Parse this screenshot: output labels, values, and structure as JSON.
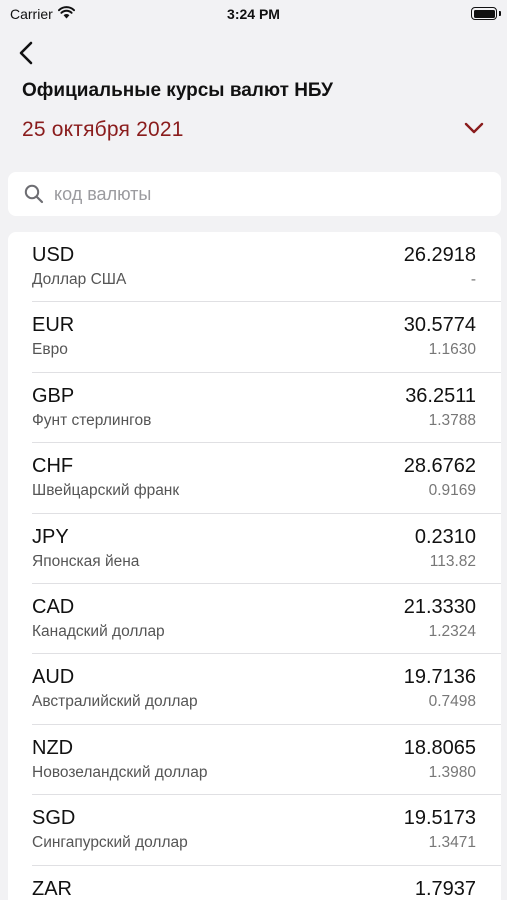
{
  "status_bar": {
    "carrier": "Carrier",
    "time": "3:24 PM"
  },
  "header": {
    "title": "Официальные курсы валют НБУ",
    "date": "25 октября 2021"
  },
  "search": {
    "placeholder": "код валюты",
    "value": ""
  },
  "colors": {
    "accent": "#8a1c1c",
    "background": "#f2f2f4"
  },
  "currencies": [
    {
      "code": "USD",
      "name": "Доллар США",
      "rate": "26.2918",
      "cross": "-"
    },
    {
      "code": "EUR",
      "name": "Евро",
      "rate": "30.5774",
      "cross": "1.1630"
    },
    {
      "code": "GBP",
      "name": "Фунт стерлингов",
      "rate": "36.2511",
      "cross": "1.3788"
    },
    {
      "code": "CHF",
      "name": "Швейцарский франк",
      "rate": "28.6762",
      "cross": "0.9169"
    },
    {
      "code": "JPY",
      "name": "Японская йена",
      "rate": "0.2310",
      "cross": "113.82"
    },
    {
      "code": "CAD",
      "name": "Канадский доллар",
      "rate": "21.3330",
      "cross": "1.2324"
    },
    {
      "code": "AUD",
      "name": "Австралийский доллар",
      "rate": "19.7136",
      "cross": "0.7498"
    },
    {
      "code": "NZD",
      "name": "Новозеландский доллар",
      "rate": "18.8065",
      "cross": "1.3980"
    },
    {
      "code": "SGD",
      "name": "Сингапурский доллар",
      "rate": "19.5173",
      "cross": "1.3471"
    },
    {
      "code": "ZAR",
      "name": "",
      "rate": "1.7937",
      "cross": ""
    }
  ]
}
